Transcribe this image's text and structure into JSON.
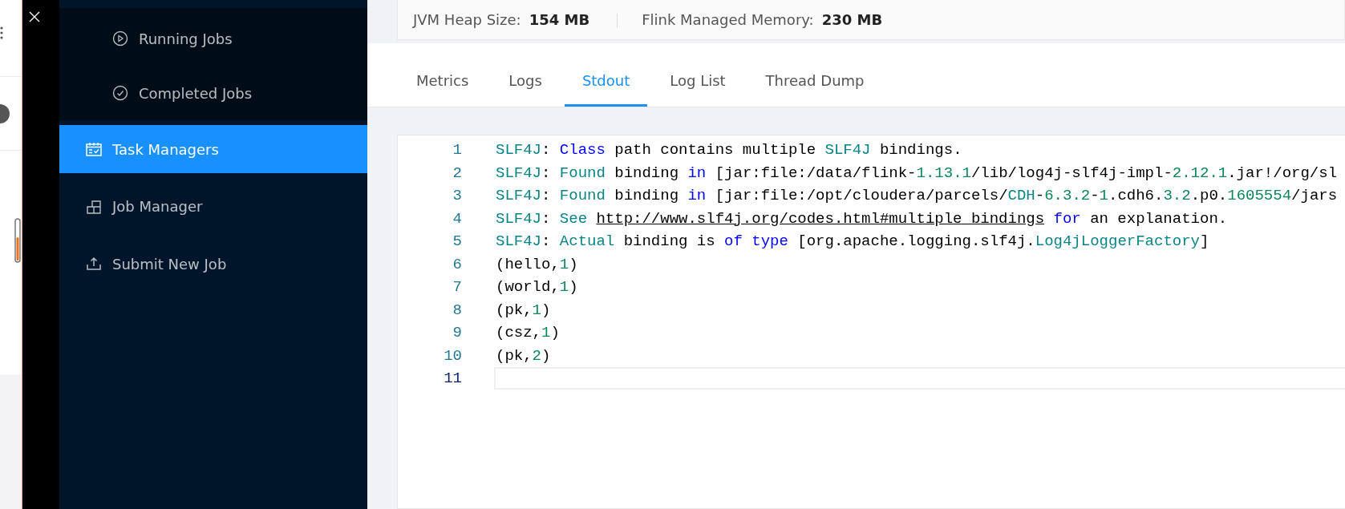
{
  "sidebar": {
    "submenu": [
      {
        "label": "Running Jobs",
        "selected": false
      },
      {
        "label": "Completed Jobs",
        "selected": false
      }
    ],
    "items": [
      {
        "label": "Task Managers",
        "selected": true
      },
      {
        "label": "Job Manager",
        "selected": false
      },
      {
        "label": "Submit New Job",
        "selected": false
      }
    ]
  },
  "stats": [
    {
      "label": "JVM Heap Size:",
      "value": "154 MB"
    },
    {
      "label": "Flink Managed Memory:",
      "value": "230 MB"
    }
  ],
  "tabs": [
    {
      "label": "Metrics",
      "selected": false
    },
    {
      "label": "Logs",
      "selected": false
    },
    {
      "label": "Stdout",
      "selected": true
    },
    {
      "label": "Log List",
      "selected": false
    },
    {
      "label": "Thread Dump",
      "selected": false
    }
  ],
  "stdout": {
    "lines": [
      {
        "number": "1",
        "active": false,
        "tokens": [
          {
            "kind": "variable",
            "text": "SLF4J"
          },
          {
            "kind": "text",
            "text": ": "
          },
          {
            "kind": "keyword",
            "text": "Class"
          },
          {
            "kind": "text",
            "text": " path contains multiple "
          },
          {
            "kind": "variable",
            "text": "SLF4J"
          },
          {
            "kind": "text",
            "text": " bindings."
          }
        ]
      },
      {
        "number": "2",
        "active": false,
        "tokens": [
          {
            "kind": "variable",
            "text": "SLF4J"
          },
          {
            "kind": "text",
            "text": ": "
          },
          {
            "kind": "variable",
            "text": "Found"
          },
          {
            "kind": "text",
            "text": " binding "
          },
          {
            "kind": "keyword",
            "text": "in"
          },
          {
            "kind": "text",
            "text": " [jar:file:/data/flink-"
          },
          {
            "kind": "number",
            "text": "1.13.1"
          },
          {
            "kind": "text",
            "text": "/lib/log4j-slf4j-impl-"
          },
          {
            "kind": "number",
            "text": "2.12.1"
          },
          {
            "kind": "text",
            "text": ".jar!/org/sl"
          }
        ]
      },
      {
        "number": "3",
        "active": false,
        "tokens": [
          {
            "kind": "variable",
            "text": "SLF4J"
          },
          {
            "kind": "text",
            "text": ": "
          },
          {
            "kind": "variable",
            "text": "Found"
          },
          {
            "kind": "text",
            "text": " binding "
          },
          {
            "kind": "keyword",
            "text": "in"
          },
          {
            "kind": "text",
            "text": " [jar:file:/opt/cloudera/parcels/"
          },
          {
            "kind": "variable",
            "text": "CDH"
          },
          {
            "kind": "text",
            "text": "-"
          },
          {
            "kind": "number",
            "text": "6.3.2"
          },
          {
            "kind": "text",
            "text": "-"
          },
          {
            "kind": "number",
            "text": "1"
          },
          {
            "kind": "text",
            "text": ".cdh6."
          },
          {
            "kind": "number",
            "text": "3.2"
          },
          {
            "kind": "text",
            "text": ".p0."
          },
          {
            "kind": "number",
            "text": "1605554"
          },
          {
            "kind": "text",
            "text": "/jars"
          }
        ]
      },
      {
        "number": "4",
        "active": false,
        "tokens": [
          {
            "kind": "variable",
            "text": "SLF4J"
          },
          {
            "kind": "text",
            "text": ": "
          },
          {
            "kind": "variable",
            "text": "See "
          },
          {
            "kind": "link",
            "text": "http://www.slf4j.org/codes.html#multiple_bindings"
          },
          {
            "kind": "keyword",
            "text": " for"
          },
          {
            "kind": "text",
            "text": " an explanation."
          }
        ]
      },
      {
        "number": "5",
        "active": false,
        "tokens": [
          {
            "kind": "variable",
            "text": "SLF4J"
          },
          {
            "kind": "text",
            "text": ": "
          },
          {
            "kind": "variable",
            "text": "Actual"
          },
          {
            "kind": "text",
            "text": " binding is "
          },
          {
            "kind": "keyword",
            "text": "of type"
          },
          {
            "kind": "text",
            "text": " [org.apache.logging.slf4j."
          },
          {
            "kind": "variable",
            "text": "Log4jLoggerFactory"
          },
          {
            "kind": "text",
            "text": "]"
          }
        ]
      },
      {
        "number": "6",
        "active": false,
        "tokens": [
          {
            "kind": "text",
            "text": "(hello,"
          },
          {
            "kind": "number",
            "text": "1"
          },
          {
            "kind": "text",
            "text": ")"
          }
        ]
      },
      {
        "number": "7",
        "active": false,
        "tokens": [
          {
            "kind": "text",
            "text": "(world,"
          },
          {
            "kind": "number",
            "text": "1"
          },
          {
            "kind": "text",
            "text": ")"
          }
        ]
      },
      {
        "number": "8",
        "active": false,
        "tokens": [
          {
            "kind": "text",
            "text": "(pk,"
          },
          {
            "kind": "number",
            "text": "1"
          },
          {
            "kind": "text",
            "text": ")"
          }
        ]
      },
      {
        "number": "9",
        "active": false,
        "tokens": [
          {
            "kind": "text",
            "text": "(csz,"
          },
          {
            "kind": "number",
            "text": "1"
          },
          {
            "kind": "text",
            "text": ")"
          }
        ]
      },
      {
        "number": "10",
        "active": false,
        "tokens": [
          {
            "kind": "text",
            "text": "(pk,"
          },
          {
            "kind": "number",
            "text": "2"
          },
          {
            "kind": "text",
            "text": ")"
          }
        ]
      },
      {
        "number": "11",
        "active": true
      }
    ]
  }
}
